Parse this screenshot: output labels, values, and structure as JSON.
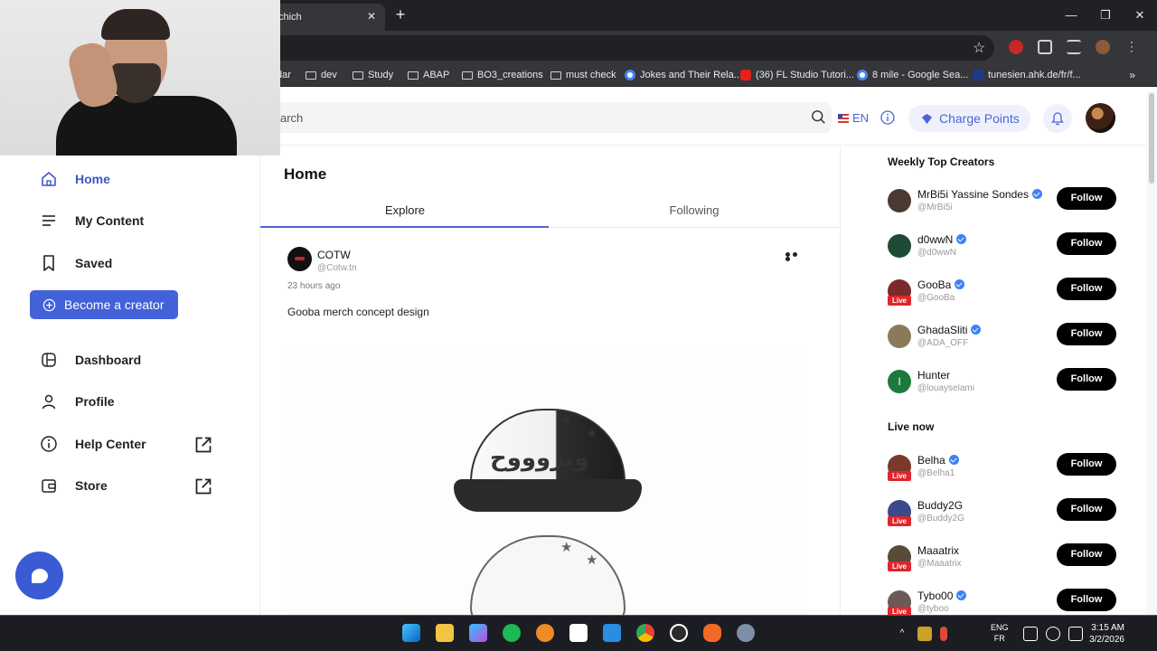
{
  "browser": {
    "tab_title": "chich",
    "new_tab": "+",
    "tab_close": "✕",
    "window_controls": [
      "—",
      "❐",
      "✕"
    ],
    "bookmarks": [
      {
        "label": "dar",
        "type": "folder"
      },
      {
        "label": "dev",
        "type": "folder"
      },
      {
        "label": "Study",
        "type": "folder"
      },
      {
        "label": "ABAP",
        "type": "folder"
      },
      {
        "label": "BO3_creations",
        "type": "folder"
      },
      {
        "label": "must check",
        "type": "folder"
      },
      {
        "label": "Jokes and Their Rela...",
        "type": "google"
      },
      {
        "label": "(36) FL Studio Tutori...",
        "type": "youtube"
      },
      {
        "label": "8 mile - Google Sea...",
        "type": "google"
      },
      {
        "label": "tunesien.ahk.de/fr/f...",
        "type": "site"
      }
    ],
    "bookmarks_more": "»"
  },
  "header": {
    "search_placeholder": "arch",
    "language": "EN",
    "charge_points": "Charge Points"
  },
  "sidebar": {
    "items": [
      {
        "label": "Home",
        "icon": "home-icon",
        "active": true
      },
      {
        "label": "My Content",
        "icon": "list-icon"
      },
      {
        "label": "Saved",
        "icon": "bookmark-icon"
      },
      {
        "label": "Dashboard",
        "icon": "dashboard-icon"
      },
      {
        "label": "Profile",
        "icon": "user-icon"
      },
      {
        "label": "Help Center",
        "icon": "info-icon",
        "external": true
      },
      {
        "label": "Store",
        "icon": "wallet-icon",
        "external": true
      }
    ],
    "become_creator": "Become a creator"
  },
  "main": {
    "title": "Home",
    "tabs": [
      "Explore",
      "Following"
    ],
    "active_tab": "Explore",
    "post": {
      "author": "COTW",
      "handle": "@Cotw.tn",
      "time": "23 hours ago",
      "text": "Gooba merch concept design",
      "image_text": "ويروووح"
    }
  },
  "right": {
    "weekly_title": "Weekly Top Creators",
    "weekly": [
      {
        "name": "MrBi5i Yassine Sondes",
        "handle": "@MrBi5i",
        "verified": true,
        "live": false,
        "color": "#4a3a32"
      },
      {
        "name": "d0wwN",
        "handle": "@d0wwN",
        "verified": true,
        "live": false,
        "color": "#1f4a36"
      },
      {
        "name": "GooBa",
        "handle": "@GooBa",
        "verified": true,
        "live": true,
        "color": "#7a2a2a"
      },
      {
        "name": "GhadaSliti",
        "handle": "@ADA_OFF",
        "verified": true,
        "live": false,
        "color": "#8a7a5a"
      },
      {
        "name": "Hunter",
        "handle": "@louayselami",
        "verified": false,
        "live": false,
        "color": "#1e7a3c",
        "initial": "I"
      }
    ],
    "live_title": "Live now",
    "live": [
      {
        "name": "Belha",
        "handle": "@Belha1",
        "verified": true,
        "live": true,
        "color": "#7a3a2a"
      },
      {
        "name": "Buddy2G",
        "handle": "@Buddy2G",
        "verified": false,
        "live": true,
        "color": "#3a4a8a"
      },
      {
        "name": "Maaatrix",
        "handle": "@Maaatrix",
        "verified": false,
        "live": true,
        "color": "#5a4a3a"
      },
      {
        "name": "Tybo00",
        "handle": "@tyboo",
        "verified": true,
        "live": true,
        "color": "#6a5a5a"
      }
    ],
    "follow_label": "Follow",
    "live_badge": "Live"
  },
  "taskbar": {
    "lang_top": "ENG",
    "lang_bottom": "FR",
    "time": "3:15 AM",
    "date": "3/2/2026"
  },
  "colors": {
    "accent": "#4361d8",
    "follow": "#000000",
    "live": "#e0262c"
  }
}
